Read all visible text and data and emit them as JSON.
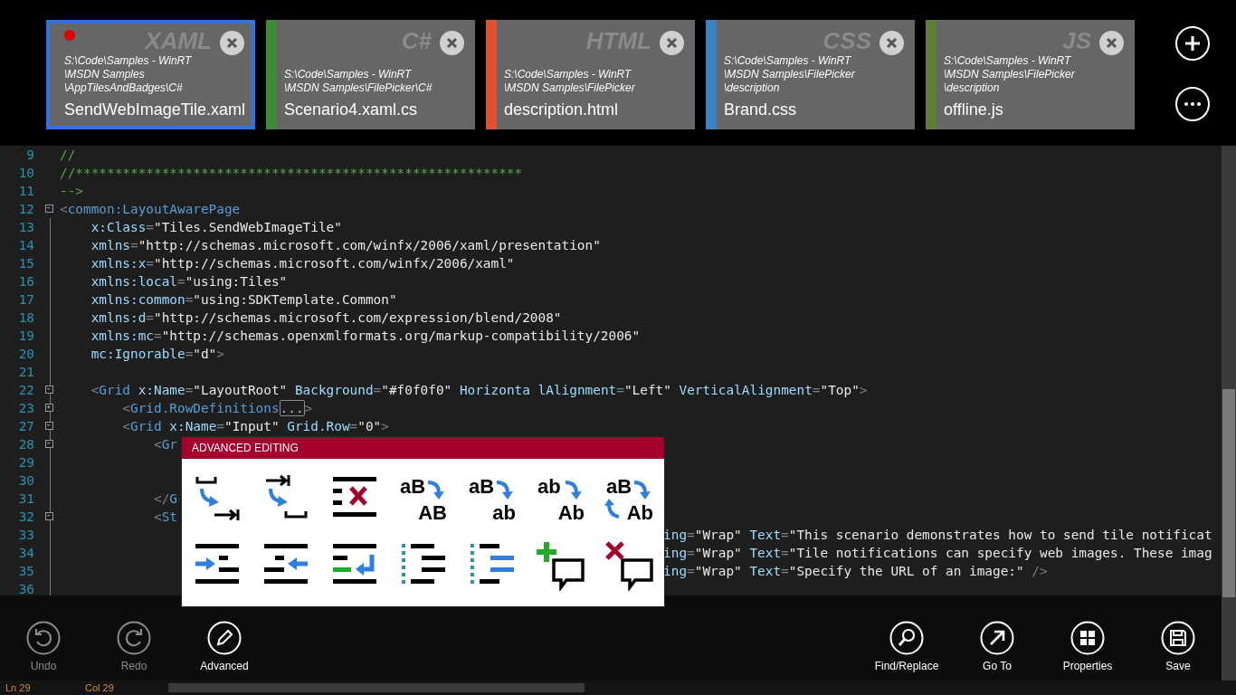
{
  "tabs": [
    {
      "path": [
        "S:\\Code\\Samples - WinRT",
        "\\MSDN Samples",
        "\\AppTilesAndBadges\\C#"
      ],
      "name": "SendWebImageTile.xaml",
      "lang": "XAML",
      "color": "#2f74e6",
      "selected": true,
      "modified": true
    },
    {
      "path": [
        "S:\\Code\\Samples - WinRT",
        "\\MSDN Samples\\FilePicker\\C#"
      ],
      "name": "Scenario4.xaml.cs",
      "lang": "C#",
      "color": "#3d8b37",
      "selected": false,
      "modified": false
    },
    {
      "path": [
        "S:\\Code\\Samples - WinRT",
        "\\MSDN Samples\\FilePicker"
      ],
      "name": "description.html",
      "lang": "HTML",
      "color": "#e1512b",
      "selected": false,
      "modified": false
    },
    {
      "path": [
        "S:\\Code\\Samples - WinRT",
        "\\MSDN Samples\\FilePicker",
        "\\description"
      ],
      "name": "Brand.css",
      "lang": "CSS",
      "color": "#3b84c4",
      "selected": false,
      "modified": false
    },
    {
      "path": [
        "S:\\Code\\Samples - WinRT",
        "\\MSDN Samples\\FilePicker",
        "\\description"
      ],
      "name": "offline.js",
      "lang": "JS",
      "color": "#5e7d36",
      "selected": false,
      "modified": false
    }
  ],
  "code": {
    "lines": [
      {
        "n": "9",
        "kind": "comment",
        "text": "//"
      },
      {
        "n": "10",
        "kind": "comment",
        "text": "//*********************************************************"
      },
      {
        "n": "11",
        "kind": "comment",
        "text": "-->"
      },
      {
        "n": "12",
        "expanded": true,
        "text": "<common:LayoutAwarePage"
      },
      {
        "n": "13",
        "text": "    x:Class=\"Tiles.SendWebImageTile\""
      },
      {
        "n": "14",
        "text": "    xmlns=\"http://schemas.microsoft.com/winfx/2006/xaml/presentation\""
      },
      {
        "n": "15",
        "text": "    xmlns:x=\"http://schemas.microsoft.com/winfx/2006/xaml\""
      },
      {
        "n": "16",
        "text": "    xmlns:local=\"using:Tiles\""
      },
      {
        "n": "17",
        "text": "    xmlns:common=\"using:SDKTemplate.Common\""
      },
      {
        "n": "18",
        "text": "    xmlns:d=\"http://schemas.microsoft.com/expression/blend/2008\""
      },
      {
        "n": "19",
        "text": "    xmlns:mc=\"http://schemas.openxmlformats.org/markup-compatibility/2006\""
      },
      {
        "n": "20",
        "text": "    mc:Ignorable=\"d\">"
      },
      {
        "n": "21"
      },
      {
        "n": "22",
        "expanded": true,
        "text": "    <Grid x:Name=\"LayoutRoot\" Background=\"#f0f0f0\" Horizonta lAlignment=\"Left\" VerticalAlignment=\"Top\">"
      },
      {
        "n": "23",
        "expanded": false,
        "text": "        <Grid.RowDefinitions",
        "box": "...",
        "tail": ">"
      },
      {
        "n": "27",
        "expanded": true,
        "text": "        <Grid x:Name=\"Input\" Grid.Row=\"0\">"
      },
      {
        "n": "28",
        "expanded": true,
        "text": "            <Gr"
      },
      {
        "n": "29"
      },
      {
        "n": "30"
      },
      {
        "n": "31",
        "text": "            </G"
      },
      {
        "n": "32",
        "expanded": true,
        "text": "            <St"
      },
      {
        "n": "33",
        "after": "ing=\"Wrap\" Text=\"This scenario demonstrates how to send tile notificat"
      },
      {
        "n": "34",
        "after": "ing=\"Wrap\" Text=\"Tile notifications can specify web images. These imag"
      },
      {
        "n": "35",
        "after": "ing=\"Wrap\" Text=\"Specify the URL of an image:\" />"
      },
      {
        "n": "36"
      }
    ]
  },
  "advanced_editing": {
    "title": "ADVANCED EDITING",
    "tools": [
      {
        "kind": "totabs"
      },
      {
        "kind": "tospaces"
      },
      {
        "kind": "deletelines"
      },
      {
        "kind": "case",
        "from": "aB",
        "to": "AB"
      },
      {
        "kind": "case",
        "from": "aB",
        "to": "ab"
      },
      {
        "kind": "case",
        "from": "ab",
        "to": "Ab"
      },
      {
        "kind": "swapcase",
        "from": "aB",
        "to": "Ab"
      },
      {
        "kind": "indent"
      },
      {
        "kind": "outdent"
      },
      {
        "kind": "wrap"
      },
      {
        "kind": "listleft"
      },
      {
        "kind": "listright"
      },
      {
        "kind": "addcomment"
      },
      {
        "kind": "removecomment"
      }
    ]
  },
  "app_bar": {
    "left": [
      {
        "kind": "undo",
        "label": "Undo",
        "disabled": true
      },
      {
        "kind": "redo",
        "label": "Redo",
        "disabled": true
      },
      {
        "kind": "advanced",
        "label": "Advanced",
        "disabled": false
      }
    ],
    "right": [
      {
        "kind": "find",
        "label": "Find/Replace",
        "disabled": false
      },
      {
        "kind": "goto",
        "label": "Go To",
        "disabled": false
      },
      {
        "kind": "properties",
        "label": "Properties",
        "disabled": false
      },
      {
        "kind": "save",
        "label": "Save",
        "disabled": false
      }
    ]
  },
  "status_bar": {
    "line": "Ln 29",
    "column": "Col 29"
  }
}
